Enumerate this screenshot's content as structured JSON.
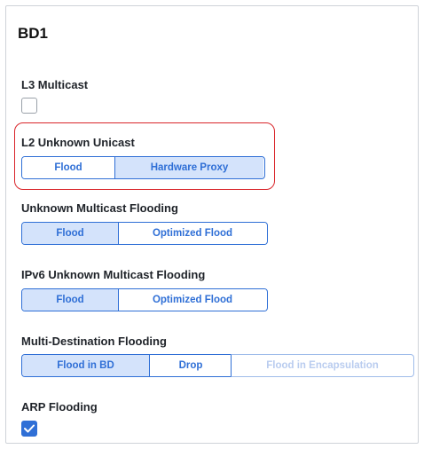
{
  "panel": {
    "title": "BD1"
  },
  "l3_multicast": {
    "label": "L3 Multicast",
    "checked": false
  },
  "l2_unknown_unicast": {
    "label": "L2 Unknown Unicast",
    "options": [
      "Flood",
      "Hardware Proxy"
    ],
    "selected": "Hardware Proxy"
  },
  "unknown_multicast_flooding": {
    "label": "Unknown Multicast Flooding",
    "options": [
      "Flood",
      "Optimized Flood"
    ],
    "selected": "Flood"
  },
  "ipv6_unknown_multicast_flooding": {
    "label": "IPv6 Unknown Multicast Flooding",
    "options": [
      "Flood",
      "Optimized Flood"
    ],
    "selected": "Flood"
  },
  "multi_destination_flooding": {
    "label": "Multi-Destination Flooding",
    "options": [
      "Flood in BD",
      "Drop",
      "Flood in Encapsulation"
    ],
    "selected": "Flood in BD",
    "disabled": [
      "Flood in Encapsulation"
    ]
  },
  "arp_flooding": {
    "label": "ARP Flooding",
    "checked": true
  },
  "colors": {
    "accent": "#2f6fd6",
    "selected_bg": "#d4e3fb",
    "highlight": "#d9252a"
  }
}
